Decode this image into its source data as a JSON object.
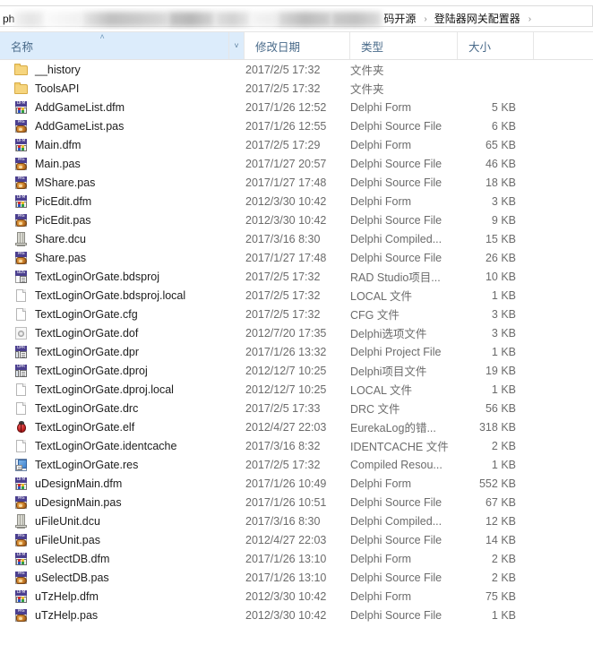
{
  "address_bar": {
    "leading_text": "ph",
    "redacted_segments": [
      "rd1",
      "rd2",
      "rd3",
      "rd4",
      "rd5",
      "rd6",
      "rd7",
      "rd8"
    ],
    "crumbs": [
      {
        "label": "码开源",
        "separator": "›"
      },
      {
        "label": "登陆器网关配置器",
        "separator": "›"
      }
    ]
  },
  "columns": {
    "name": "名称",
    "date": "修改日期",
    "type": "类型",
    "size": "大小",
    "sorted_by": "名称",
    "sort_direction": "ascending",
    "sort_caret": "˄",
    "dropdown_chevron": "˅"
  },
  "files": [
    {
      "name": "__history",
      "date": "2017/2/5 17:32",
      "type": "文件夹",
      "size": "",
      "icon": "folder-icon"
    },
    {
      "name": "ToolsAPI",
      "date": "2017/2/5 17:32",
      "type": "文件夹",
      "size": "",
      "icon": "folder-icon"
    },
    {
      "name": "AddGameList.dfm",
      "date": "2017/1/26 12:52",
      "type": "Delphi Form",
      "size": "5 KB",
      "icon": "delphi-form-icon"
    },
    {
      "name": "AddGameList.pas",
      "date": "2017/1/26 12:55",
      "type": "Delphi Source File",
      "size": "6 KB",
      "icon": "delphi-source-icon"
    },
    {
      "name": "Main.dfm",
      "date": "2017/2/5 17:29",
      "type": "Delphi Form",
      "size": "65 KB",
      "icon": "delphi-form-icon"
    },
    {
      "name": "Main.pas",
      "date": "2017/1/27 20:57",
      "type": "Delphi Source File",
      "size": "46 KB",
      "icon": "delphi-source-icon"
    },
    {
      "name": "MShare.pas",
      "date": "2017/1/27 17:48",
      "type": "Delphi Source File",
      "size": "18 KB",
      "icon": "delphi-source-icon"
    },
    {
      "name": "PicEdit.dfm",
      "date": "2012/3/30 10:42",
      "type": "Delphi Form",
      "size": "3 KB",
      "icon": "delphi-form-icon"
    },
    {
      "name": "PicEdit.pas",
      "date": "2012/3/30 10:42",
      "type": "Delphi Source File",
      "size": "9 KB",
      "icon": "delphi-source-icon"
    },
    {
      "name": "Share.dcu",
      "date": "2017/3/16 8:30",
      "type": "Delphi Compiled...",
      "size": "15 KB",
      "icon": "delphi-compiled-icon"
    },
    {
      "name": "Share.pas",
      "date": "2017/1/27 17:48",
      "type": "Delphi Source File",
      "size": "26 KB",
      "icon": "delphi-source-icon"
    },
    {
      "name": "TextLoginOrGate.bdsproj",
      "date": "2017/2/5 17:32",
      "type": "RAD Studio项目...",
      "size": "10 KB",
      "icon": "bdsproj-icon"
    },
    {
      "name": "TextLoginOrGate.bdsproj.local",
      "date": "2017/2/5 17:32",
      "type": "LOCAL 文件",
      "size": "1 KB",
      "icon": "blank-page-icon"
    },
    {
      "name": "TextLoginOrGate.cfg",
      "date": "2017/2/5 17:32",
      "type": "CFG 文件",
      "size": "3 KB",
      "icon": "blank-page-icon"
    },
    {
      "name": "TextLoginOrGate.dof",
      "date": "2012/7/20 17:35",
      "type": "Delphi选项文件",
      "size": "3 KB",
      "icon": "delphi-options-icon"
    },
    {
      "name": "TextLoginOrGate.dpr",
      "date": "2017/1/26 13:32",
      "type": "Delphi Project File",
      "size": "1 KB",
      "icon": "delphi-project-icon"
    },
    {
      "name": "TextLoginOrGate.dproj",
      "date": "2012/12/7 10:25",
      "type": "Delphi项目文件",
      "size": "19 KB",
      "icon": "delphi-project-icon"
    },
    {
      "name": "TextLoginOrGate.dproj.local",
      "date": "2012/12/7 10:25",
      "type": "LOCAL 文件",
      "size": "1 KB",
      "icon": "blank-page-icon"
    },
    {
      "name": "TextLoginOrGate.drc",
      "date": "2017/2/5 17:33",
      "type": "DRC 文件",
      "size": "56 KB",
      "icon": "blank-page-icon"
    },
    {
      "name": "TextLoginOrGate.elf",
      "date": "2012/4/27 22:03",
      "type": "EurekaLog的错...",
      "size": "318 KB",
      "icon": "eurekalog-bug-icon"
    },
    {
      "name": "TextLoginOrGate.identcache",
      "date": "2017/3/16 8:32",
      "type": "IDENTCACHE 文件",
      "size": "2 KB",
      "icon": "blank-page-icon"
    },
    {
      "name": "TextLoginOrGate.res",
      "date": "2017/2/5 17:32",
      "type": "Compiled Resou...",
      "size": "1 KB",
      "icon": "compiled-resource-icon"
    },
    {
      "name": "uDesignMain.dfm",
      "date": "2017/1/26 10:49",
      "type": "Delphi Form",
      "size": "552 KB",
      "icon": "delphi-form-icon"
    },
    {
      "name": "uDesignMain.pas",
      "date": "2017/1/26 10:51",
      "type": "Delphi Source File",
      "size": "67 KB",
      "icon": "delphi-source-icon"
    },
    {
      "name": "uFileUnit.dcu",
      "date": "2017/3/16 8:30",
      "type": "Delphi Compiled...",
      "size": "12 KB",
      "icon": "delphi-compiled-icon"
    },
    {
      "name": "uFileUnit.pas",
      "date": "2012/4/27 22:03",
      "type": "Delphi Source File",
      "size": "14 KB",
      "icon": "delphi-source-icon"
    },
    {
      "name": "uSelectDB.dfm",
      "date": "2017/1/26 13:10",
      "type": "Delphi Form",
      "size": "2 KB",
      "icon": "delphi-form-icon"
    },
    {
      "name": "uSelectDB.pas",
      "date": "2017/1/26 13:10",
      "type": "Delphi Source File",
      "size": "2 KB",
      "icon": "delphi-source-icon"
    },
    {
      "name": "uTzHelp.dfm",
      "date": "2012/3/30 10:42",
      "type": "Delphi Form",
      "size": "75 KB",
      "icon": "delphi-form-icon"
    },
    {
      "name": "uTzHelp.pas",
      "date": "2012/3/30 10:42",
      "type": "Delphi Source File",
      "size": "1 KB",
      "icon": "delphi-source-icon"
    }
  ],
  "icon_labels": {
    "delphi-form-icon": "DFM",
    "delphi-source-icon": "PAS",
    "bdsproj-icon": "BDS",
    "delphi-project-icon": "DPR"
  },
  "colors": {
    "header_sorted_bg": "#dcecfb",
    "header_text": "#4a6b8a",
    "row_text": "#202020",
    "secondary_text": "#6b6b6b",
    "folder": "#f6d57e"
  }
}
